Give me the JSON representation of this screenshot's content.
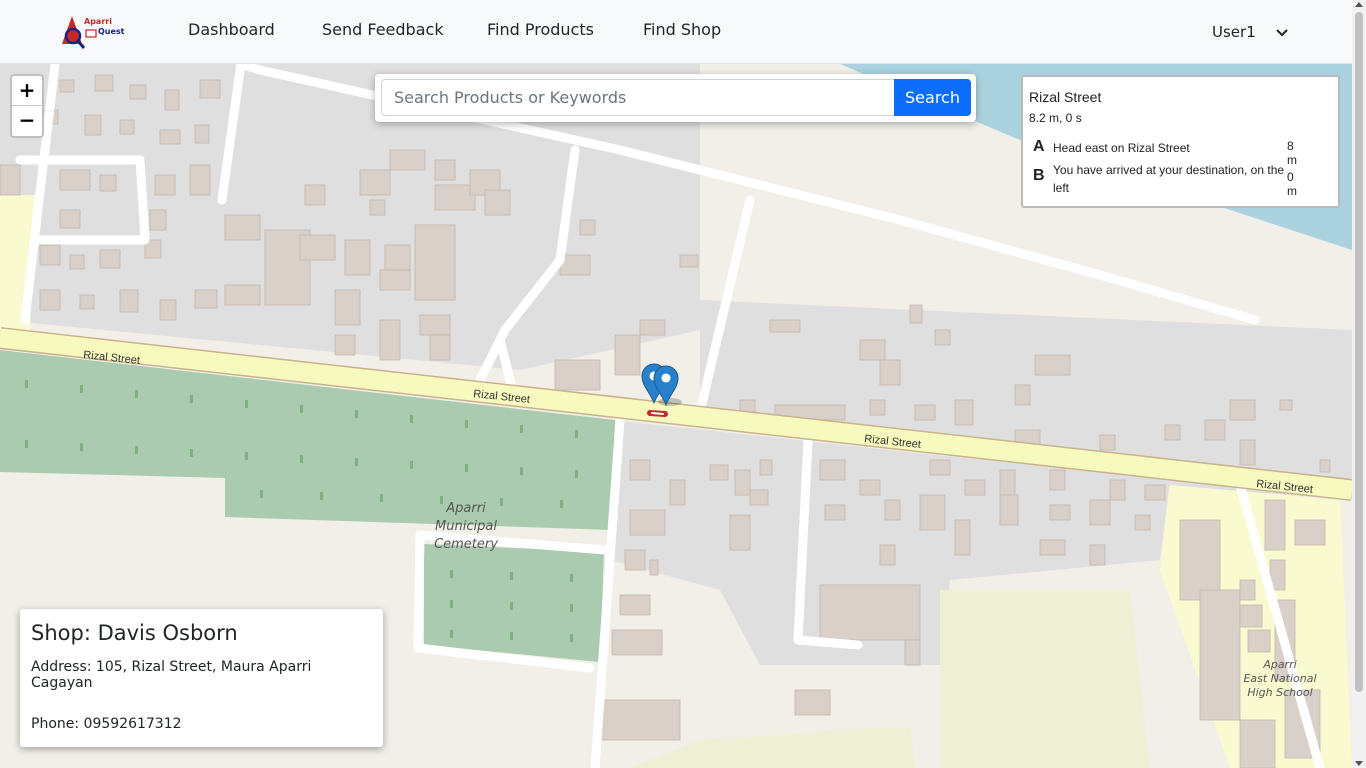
{
  "nav": {
    "links": [
      "Dashboard",
      "Send Feedback",
      "Find Products",
      "Find Shop"
    ],
    "user": "User1",
    "logo_top": "Aparri",
    "logo_bottom": "Quest"
  },
  "search": {
    "placeholder": "Search Products or Keywords",
    "button": "Search"
  },
  "zoom": {
    "in": "+",
    "out": "−"
  },
  "route": {
    "title": "Rizal Street",
    "summary": "8.2 m, 0 s",
    "steps": [
      {
        "letter": "A",
        "text": "Head east on Rizal Street",
        "distance": "8 m"
      },
      {
        "letter": "B",
        "text": "You have arrived at your destination, on the left",
        "distance": "0 m"
      }
    ]
  },
  "shop": {
    "name": "Shop: Davis Osborn",
    "address": "Address: 105, Rizal Street, Maura Aparri Cagayan",
    "phone": "Phone: 09592617312"
  },
  "map": {
    "street_labels": [
      "Rizal Street",
      "Rizal Street",
      "Rizal Street",
      "Rizal Street"
    ],
    "cemetery": [
      "Aparri",
      "Municipal",
      "Cemetery"
    ],
    "school": [
      "Aparri",
      "East National",
      "High School"
    ]
  },
  "colors": {
    "primary": "#0d6efd",
    "road_main": "#f7fabf",
    "road_minor": "#ffffff",
    "building": "#d9d0c9",
    "cemetery": "#aacbaf",
    "water": "#aad3df",
    "residential": "#e0dfdf"
  }
}
